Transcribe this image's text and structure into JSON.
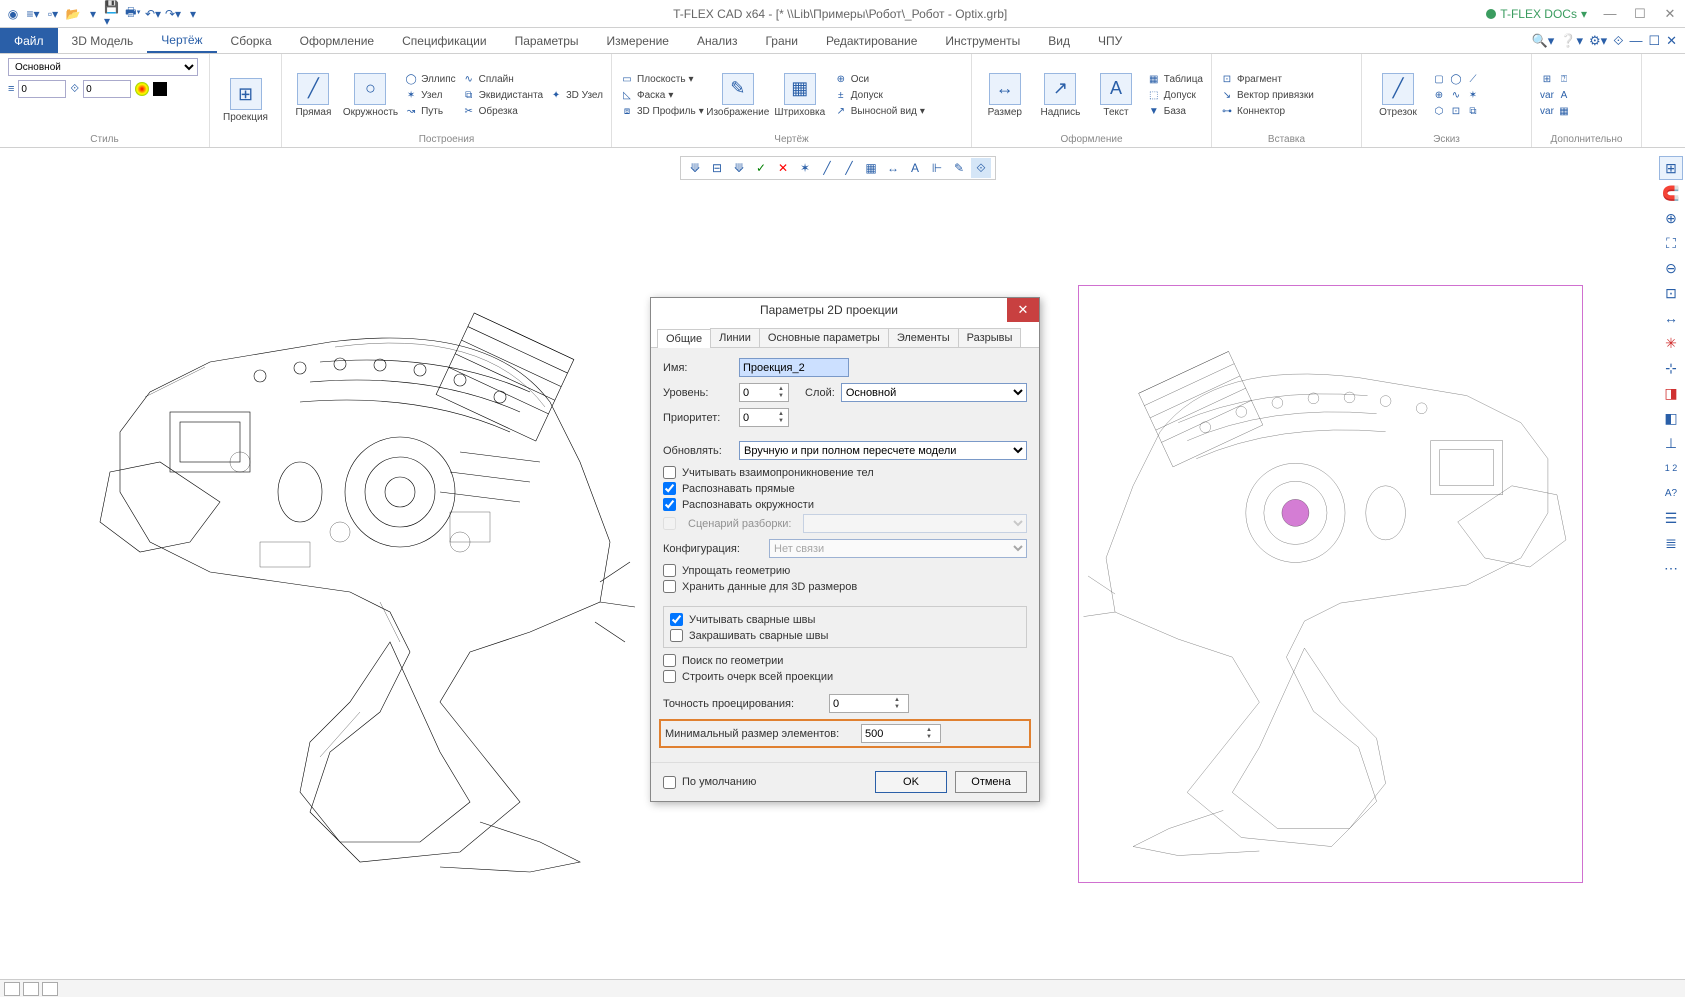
{
  "title": "T-FLEX CAD x64 - [* \\\\Lib\\Примеры\\Робот\\_Робот - Optix.grb]",
  "docs": "T-FLEX DOCs",
  "tabs": {
    "file": "Файл",
    "items": [
      "3D Модель",
      "Чертёж",
      "Сборка",
      "Оформление",
      "Спецификации",
      "Параметры",
      "Измерение",
      "Анализ",
      "Грани",
      "Редактирование",
      "Инструменты",
      "Вид",
      "ЧПУ"
    ],
    "active": 1
  },
  "ribbon": {
    "style": {
      "label": "Стиль",
      "combo": "Основной",
      "n1": "0",
      "n2": "0"
    },
    "proj": {
      "label": "Проекция"
    },
    "constr": {
      "label": "Построения",
      "line": "Прямая",
      "circle": "Окружность",
      "ellipse": "Эллипс",
      "spline": "Сплайн",
      "node": "Узел",
      "equi": "Эквидистанта",
      "node3d": "3D Узел",
      "path": "Путь",
      "trim": "Обрезка"
    },
    "draw": {
      "label": "Чертёж",
      "plane": "Плоскость",
      "chamf": "Фаска",
      "profile": "3D Профиль",
      "image": "Изображение",
      "hatch": "Штриховка",
      "axes": "Оси",
      "tol": "Допуск",
      "leader": "Выносной вид"
    },
    "annot": {
      "label": "Оформление",
      "dim": "Размер",
      "note": "Надпись",
      "text": "Текст",
      "table": "Таблица",
      "tol": "Допуск",
      "base": "База"
    },
    "insert": {
      "label": "Вставка",
      "frag": "Фрагмент",
      "vec": "Вектор привязки",
      "conn": "Коннектор"
    },
    "sketch": {
      "label": "Эскиз",
      "seg": "Отрезок"
    },
    "extra": {
      "label": "Дополнительно"
    }
  },
  "dialog": {
    "title": "Параметры 2D проекции",
    "tabs": [
      "Общие",
      "Линии",
      "Основные параметры",
      "Элементы",
      "Разрывы"
    ],
    "active": 0,
    "name_l": "Имя:",
    "name_v": "Проекция_2",
    "level_l": "Уровень:",
    "level_v": "0",
    "layer_l": "Слой:",
    "layer_v": "Основной",
    "prio_l": "Приоритет:",
    "prio_v": "0",
    "upd_l": "Обновлять:",
    "upd_v": "Вручную и при полном пересчете модели",
    "cb1": "Учитывать взаимопроникновение тел",
    "cb2": "Распознавать прямые",
    "cb3": "Распознавать окружности",
    "scen_l": "Сценарий разборки:",
    "conf_l": "Конфигурация:",
    "conf_v": "Нет связи",
    "cb4": "Упрощать геометрию",
    "cb5": "Хранить данные для 3D размеров",
    "cb6": "Учитывать сварные швы",
    "cb7": "Закрашивать сварные швы",
    "cb8": "Поиск по геометрии",
    "cb9": "Строить очерк всей проекции",
    "prec_l": "Точность проецирования:",
    "prec_v": "0",
    "min_l": "Минимальный размер элементов:",
    "min_v": "500",
    "def": "По умолчанию",
    "ok": "OK",
    "cancel": "Отмена"
  }
}
